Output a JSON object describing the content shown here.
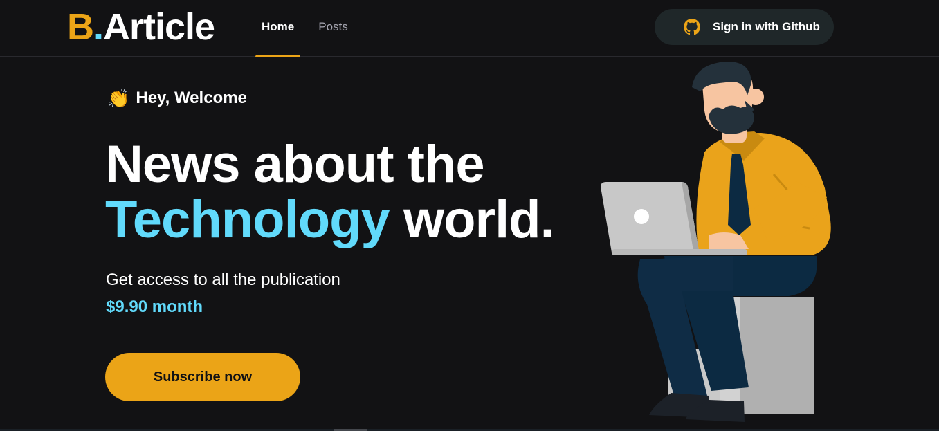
{
  "header": {
    "logo": {
      "letter": "B",
      "dot": ".",
      "rest": "Article"
    },
    "nav": [
      {
        "label": "Home",
        "active": true
      },
      {
        "label": "Posts",
        "active": false
      }
    ],
    "signin": {
      "label": "Sign in with Github",
      "icon": "github-icon",
      "icon_color": "#eba417"
    }
  },
  "hero": {
    "welcome_emoji": "👏",
    "welcome": "Hey, Welcome",
    "headline_line1": "News about the",
    "headline_accent": "Technology",
    "headline_rest": "world.",
    "subtitle": "Get access to all the publication",
    "price": "$9.90 month",
    "cta": "Subscribe now"
  },
  "colors": {
    "background": "#121214",
    "accent_yellow": "#eba417",
    "accent_cyan": "#61dafb",
    "button_dark": "#1f2729"
  }
}
